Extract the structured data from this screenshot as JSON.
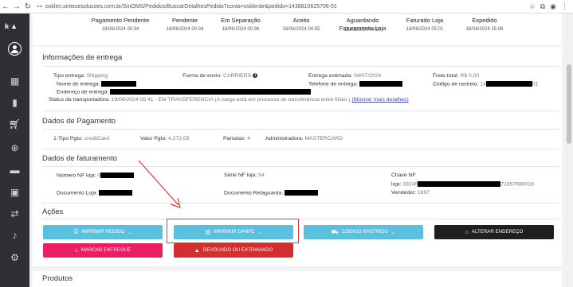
{
  "browser": {
    "url": "osklen.sintesesolucoes.com.br/SinOMS/Pedidos/BuscarDetalhesPedido?conta=osklenbr&pedido=1438810625706-01",
    "back_icon": "arrow-left-icon",
    "forward_icon": "arrow-right-icon",
    "reload_icon": "reload-icon"
  },
  "sidebar": {
    "logo_main": "k",
    "logo_accent": "-",
    "items": [
      "avatar",
      "dashboard-icon",
      "chart-icon",
      "cart-icon",
      "cart-plus-icon",
      "store-icon",
      "box-icon",
      "transfer-icon",
      "bell-icon",
      "gear-icon"
    ]
  },
  "timeline": [
    {
      "label": "Pagamento Pendente",
      "date": "18/06/2024 00:34"
    },
    {
      "label": "Pendente",
      "date": "18/06/2024 00:34"
    },
    {
      "label": "Em Separação",
      "date": "18/06/2024 00:36"
    },
    {
      "label": "Aceito",
      "date": "18/06/2024 04:55"
    },
    {
      "label": "Aguardando Faturamento Loja",
      "date": "18/06/2024 04:57"
    },
    {
      "label": "Faturado Loja",
      "date": "18/06/2024 05:01"
    },
    {
      "label": "Expedido",
      "date": "18/06/2024 15:06"
    }
  ],
  "entrega": {
    "title": "Informações de entrega",
    "tipo_label": "Tipo entrega:",
    "tipo_val": "Shipping",
    "forma_label": "Forma de envio:",
    "forma_val": "CARRIERS",
    "estimada_label": "Entrega estimada:",
    "estimada_val": "04/07/2024",
    "frete_label": "Frete total:",
    "frete_val": "R$ 0,00",
    "nome_label": "Nome de entrega:",
    "telefone_label": "Telefone de entrega:",
    "rastreio_label": "Código de rastreio:",
    "rastreio_prefix": "14",
    "rastreio_suffix": "01",
    "endereco_label": "Endereço de entrega:",
    "status_label": "Status da transportadora:",
    "status_val": "19/06/2024 05:41 - EM TRANSFERENCIA (A carga está em processo de transferência entre filiais.)",
    "mostrar_mais": "(Mostrar mais detalhes)"
  },
  "pagamento": {
    "title": "Dados de Pagamento",
    "tipo_label": "1-Tipo Pgto:",
    "tipo_val": "creditCard",
    "valor_label": "Valor Pgto:",
    "valor_val": "4.272,05",
    "parcelas_label": "Parcelas:",
    "parcelas_val": "4",
    "admin_label": "Administradora:",
    "admin_val": "MASTERCARD"
  },
  "faturamento": {
    "title": "Dados de faturamento",
    "numero_label": "Número NF loja:",
    "numero_prefix": "0",
    "serie_label": "Série NF loja:",
    "serie_val": "54",
    "chave_label": "Chave NF",
    "loja_label": "loja:",
    "loja_prefix": "33240",
    "loja_suffix": "71857986016",
    "documento_label": "Documento Loja:",
    "retaguarda_label": "Documento Retaguarda:",
    "vendedor_label": "Vendedor:",
    "vendedor_val": "1997"
  },
  "acoes": {
    "title": "Ações",
    "imprimir_pedido": "IMPRIMIR PEDIDO",
    "imprimir_danfe": "IMPRIMIR DANFE",
    "codigo_rastreio": "CÓDIGO RASTREIO",
    "alterar_endereco": "ALTERAR ENDEREÇO",
    "marcar_entregue": "MARCAR ENTREGUE",
    "devolvido": "DEVOLVIDO OU EXTRAVIADO"
  },
  "produtos": {
    "title": "Produtos"
  },
  "colors": {
    "cyan": "#5bc0de",
    "dark": "#1e1f21",
    "pink": "#e91e63",
    "red": "#d32f2f",
    "annotation": "#e53935"
  }
}
